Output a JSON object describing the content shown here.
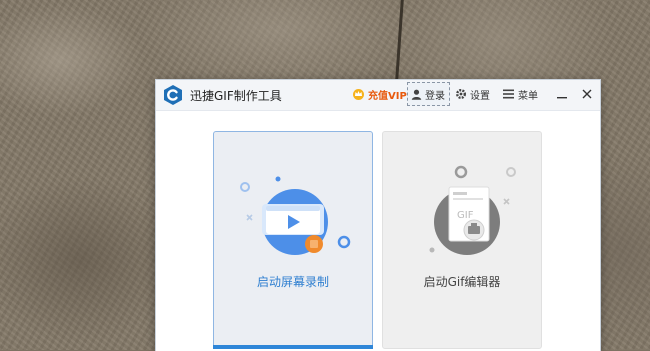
{
  "app": {
    "title": "迅捷GIF制作工具",
    "accent": "#2f86d8"
  },
  "toolbar": {
    "vip_label": "充值VIP",
    "login_label": "登录",
    "settings_label": "设置",
    "menu_label": "菜单"
  },
  "cards": {
    "record_label": "启动屏幕录制",
    "editor_label": "启动Gif编辑器",
    "editor_doc_text": "GIF"
  },
  "colors": {
    "vip": "#e8590c",
    "record_blue": "#4d8fe8",
    "record_orange": "#f08a2c",
    "editor_gray": "#7d7d7d"
  }
}
